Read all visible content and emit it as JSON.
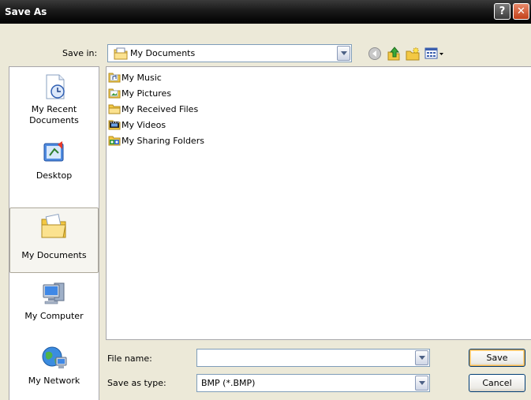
{
  "window": {
    "title": "Save As",
    "help_glyph": "?",
    "close_glyph": "✕"
  },
  "toolbar": {
    "save_in_label": "Save in:",
    "save_in_value": "My Documents",
    "icons": [
      "back-icon",
      "up-one-level-icon",
      "new-folder-icon",
      "views-menu-icon"
    ]
  },
  "places": [
    {
      "label": "My Recent Documents",
      "icon": "recent-documents-icon"
    },
    {
      "label": "Desktop",
      "icon": "desktop-icon"
    },
    {
      "label": "My Documents",
      "icon": "my-documents-icon",
      "selected": true
    },
    {
      "label": "My Computer",
      "icon": "my-computer-icon"
    },
    {
      "label": "My Network",
      "icon": "my-network-icon"
    }
  ],
  "files": [
    {
      "name": "My Music",
      "icon": "music-folder-icon"
    },
    {
      "name": "My Pictures",
      "icon": "pictures-folder-icon"
    },
    {
      "name": "My Received Files",
      "icon": "folder-icon"
    },
    {
      "name": "My Videos",
      "icon": "videos-folder-icon"
    },
    {
      "name": "My Sharing Folders",
      "icon": "sharing-folders-icon"
    }
  ],
  "form": {
    "file_name_label": "File name:",
    "file_name_value": "",
    "save_as_type_label": "Save as type:",
    "save_as_type_value": "BMP (*.BMP)"
  },
  "buttons": {
    "save": "Save",
    "cancel": "Cancel"
  },
  "colors": {
    "title_bar": "#1a1a1a",
    "close_button": "#c2401a",
    "dialog_bg": "#ece9d8",
    "combo_border": "#7f9db9"
  }
}
